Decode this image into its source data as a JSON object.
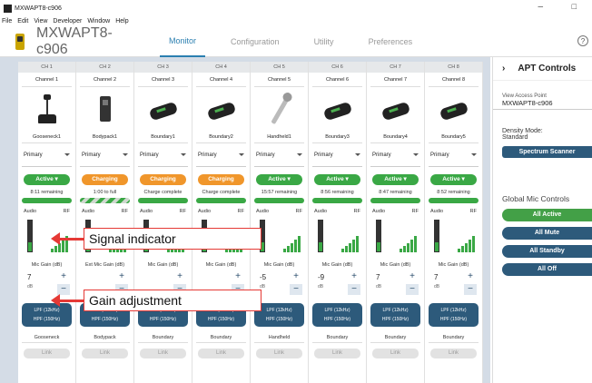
{
  "window": {
    "title": "MXWAPT8-c906",
    "min_glyph": "–",
    "max_glyph": "□"
  },
  "menu": [
    "File",
    "Edit",
    "View",
    "Developer",
    "Window",
    "Help"
  ],
  "header": {
    "device_name": "MXWAPT8-c906",
    "tabs": [
      "Monitor",
      "Configuration",
      "Utility",
      "Preferences"
    ],
    "active_tab": "Monitor",
    "help": "?"
  },
  "channels": [
    {
      "ch": "CH 1",
      "name": "Channel 1",
      "device": "Gooseneck1",
      "type": "gooseneck",
      "mode": "Primary",
      "state": "Active ▾",
      "state_kind": "active",
      "remaining": "8:11 remaining",
      "bar_kind": "full",
      "audio": "Audio",
      "rf": "RF",
      "gain_label": "Mic Gain (dB)",
      "gain": "7",
      "db": "dB",
      "lpf": "LPF (12kHz)",
      "hpf": "HPF (150Hz)",
      "family": "Gooseneck",
      "link": "Link"
    },
    {
      "ch": "CH 2",
      "name": "Channel 2",
      "device": "Bodypack1",
      "type": "bodypack",
      "mode": "Primary",
      "state": "Charging",
      "state_kind": "charging",
      "remaining": "1:00 to full",
      "bar_kind": "charge",
      "audio": "Audio",
      "rf": "RF",
      "gain_label": "Ext Mic Gain (dB)",
      "gain": "",
      "db": "",
      "lpf": "LPF (12kHz)",
      "hpf": "HPF (150Hz)",
      "family": "Bodypack",
      "link": "Link"
    },
    {
      "ch": "CH 3",
      "name": "Channel 3",
      "device": "Boundary1",
      "type": "boundary",
      "mode": "Primary",
      "state": "Charging",
      "state_kind": "charging",
      "remaining": "Charge complete",
      "bar_kind": "full",
      "audio": "Audio",
      "rf": "RF",
      "gain_label": "Mic Gain (dB)",
      "gain": "",
      "db": "",
      "lpf": "LPF (12kHz)",
      "hpf": "HPF (150Hz)",
      "family": "Boundary",
      "link": "Link"
    },
    {
      "ch": "CH 4",
      "name": "Channel 4",
      "device": "Boundary2",
      "type": "boundary",
      "mode": "Primary",
      "state": "Charging",
      "state_kind": "charging",
      "remaining": "Charge complete",
      "bar_kind": "full",
      "audio": "Audio",
      "rf": "RF",
      "gain_label": "Mic Gain (dB)",
      "gain": "",
      "db": "",
      "lpf": "LPF (12kHz)",
      "hpf": "HPF (150Hz)",
      "family": "Boundary",
      "link": "Link"
    },
    {
      "ch": "CH 5",
      "name": "Channel 5",
      "device": "Handheld1",
      "type": "handheld",
      "mode": "Primary",
      "state": "Active ▾",
      "state_kind": "active",
      "remaining": "15:57 remaining",
      "bar_kind": "full",
      "audio": "Audio",
      "rf": "RF",
      "gain_label": "Mic Gain (dB)",
      "gain": "-5",
      "db": "dB",
      "lpf": "LPF (12kHz)",
      "hpf": "HPF (150Hz)",
      "family": "Handheld",
      "link": "Link"
    },
    {
      "ch": "CH 6",
      "name": "Channel 6",
      "device": "Boundary3",
      "type": "boundary",
      "mode": "Primary",
      "state": "Active ▾",
      "state_kind": "active",
      "remaining": "8:56 remaining",
      "bar_kind": "full",
      "audio": "Audio",
      "rf": "RF",
      "gain_label": "Mic Gain (dB)",
      "gain": "-9",
      "db": "dB",
      "lpf": "LPF (12kHz)",
      "hpf": "HPF (150Hz)",
      "family": "Boundary",
      "link": "Link"
    },
    {
      "ch": "CH 7",
      "name": "Channel 7",
      "device": "Boundary4",
      "type": "boundary",
      "mode": "Primary",
      "state": "Active ▾",
      "state_kind": "active",
      "remaining": "8:47 remaining",
      "bar_kind": "full",
      "audio": "Audio",
      "rf": "RF",
      "gain_label": "Mic Gain (dB)",
      "gain": "7",
      "db": "dB",
      "lpf": "LPF (12kHz)",
      "hpf": "HPF (150Hz)",
      "family": "Boundary",
      "link": "Link"
    },
    {
      "ch": "CH 8",
      "name": "Channel 8",
      "device": "Boundary5",
      "type": "boundary",
      "mode": "Primary",
      "state": "Active ▾",
      "state_kind": "active",
      "remaining": "8:52 remaining",
      "bar_kind": "full",
      "audio": "Audio",
      "rf": "RF",
      "gain_label": "Mic Gain (dB)",
      "gain": "7",
      "db": "dB",
      "lpf": "LPF (12kHz)",
      "hpf": "HPF (150Hz)",
      "family": "Boundary",
      "link": "Link"
    }
  ],
  "panel": {
    "title": "APT Controls",
    "chevron": "›",
    "access_point_label": "View Access Point",
    "access_point_value": "MXWAPT8-c906",
    "density_label": "Density Mode:",
    "density_value": "Standard",
    "spectrum": "Spectrum Scanner",
    "global_title": "Global Mic Controls",
    "global_buttons": [
      {
        "label": "All Active",
        "color": "#43a047"
      },
      {
        "label": "All Mute",
        "color": "#2d5a7b"
      },
      {
        "label": "All Standby",
        "color": "#2d5a7b"
      },
      {
        "label": "All Off",
        "color": "#2d5a7b"
      }
    ]
  },
  "callouts": {
    "signal": "Signal indicator",
    "gain": "Gain adjustment"
  }
}
